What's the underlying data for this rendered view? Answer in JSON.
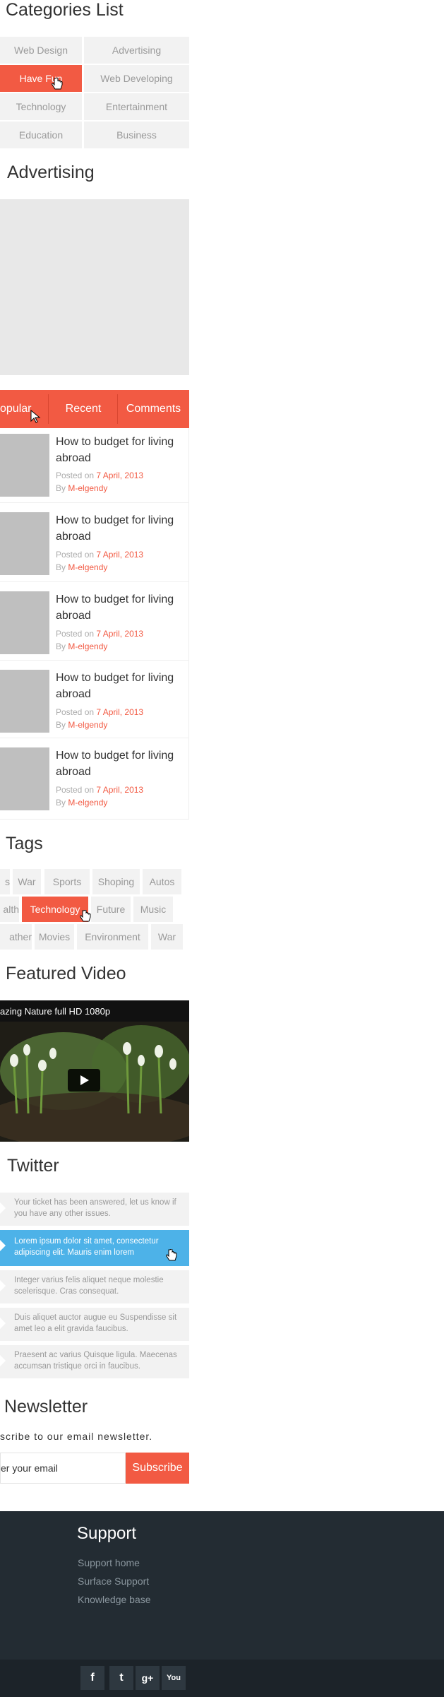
{
  "categories": {
    "title": "Categories List",
    "items": [
      "Web Design",
      "Advertising",
      "Have Fun",
      "Web Developing",
      "Technology",
      "Entertainment",
      "Education",
      "Business"
    ],
    "active": "Have Fun"
  },
  "advertising": {
    "title": "Advertising"
  },
  "tabs": {
    "items": [
      "opular",
      "Recent",
      "Comments"
    ],
    "active": "opular"
  },
  "posts": [
    {
      "title": "How to budget for living abroad",
      "posted_label": "Posted on",
      "date": "7 April, 2013",
      "by_label": "By",
      "author": "M-elgendy"
    },
    {
      "title": "How to budget for living abroad",
      "posted_label": "Posted on",
      "date": "7 April, 2013",
      "by_label": "By",
      "author": "M-elgendy"
    },
    {
      "title": "How to budget for living abroad",
      "posted_label": "Posted on",
      "date": "7 April, 2013",
      "by_label": "By",
      "author": "M-elgendy"
    },
    {
      "title": "How to budget for living abroad",
      "posted_label": "Posted on",
      "date": "7 April, 2013",
      "by_label": "By",
      "author": "M-elgendy"
    },
    {
      "title": "How to budget for living abroad",
      "posted_label": "Posted on",
      "date": "7 April, 2013",
      "by_label": "By",
      "author": "M-elgendy"
    }
  ],
  "tags": {
    "title": "Tags",
    "rows": [
      [
        "s",
        "War",
        "Sports",
        "Shoping",
        "Autos"
      ],
      [
        "alth",
        "Technology",
        "Future",
        "Music"
      ],
      [
        "ather",
        "Movies",
        "Environment",
        "War"
      ]
    ],
    "active": "Technology"
  },
  "video": {
    "title": "Featured Video",
    "caption": "azing Nature full HD 1080p"
  },
  "twitter": {
    "title": "Twitter",
    "tweets": [
      "Your ticket has been answered, let us know if you have any other issues.",
      "Lorem ipsum dolor sit amet, consectetur adipiscing elit. Mauris enim lorem",
      "Integer varius felis aliquet neque molestie scelerisque. Cras consequat.",
      "Duis aliquet auctor augue eu Suspendisse sit amet leo a elit gravida faucibus.",
      "Praesent ac varius Quisque ligula. Maecenas accumsan tristique orci in faucibus."
    ],
    "active_index": 1
  },
  "newsletter": {
    "title": "Newsletter",
    "subtitle": "scribe to our email newsletter.",
    "placeholder": "er your email",
    "button": "Subscribe"
  },
  "footer": {
    "support_title": "Support",
    "links": [
      "Support home",
      "Surface Support",
      "Knowledge base"
    ],
    "social": [
      "facebook-icon",
      "twitter-icon",
      "google-plus-icon",
      "youtube-icon"
    ],
    "social_glyphs": [
      "f",
      "t",
      "g+",
      "You"
    ]
  },
  "colors": {
    "accent": "#f25a43",
    "twitter_active": "#4db2e8",
    "footer_bg": "#232c33"
  }
}
